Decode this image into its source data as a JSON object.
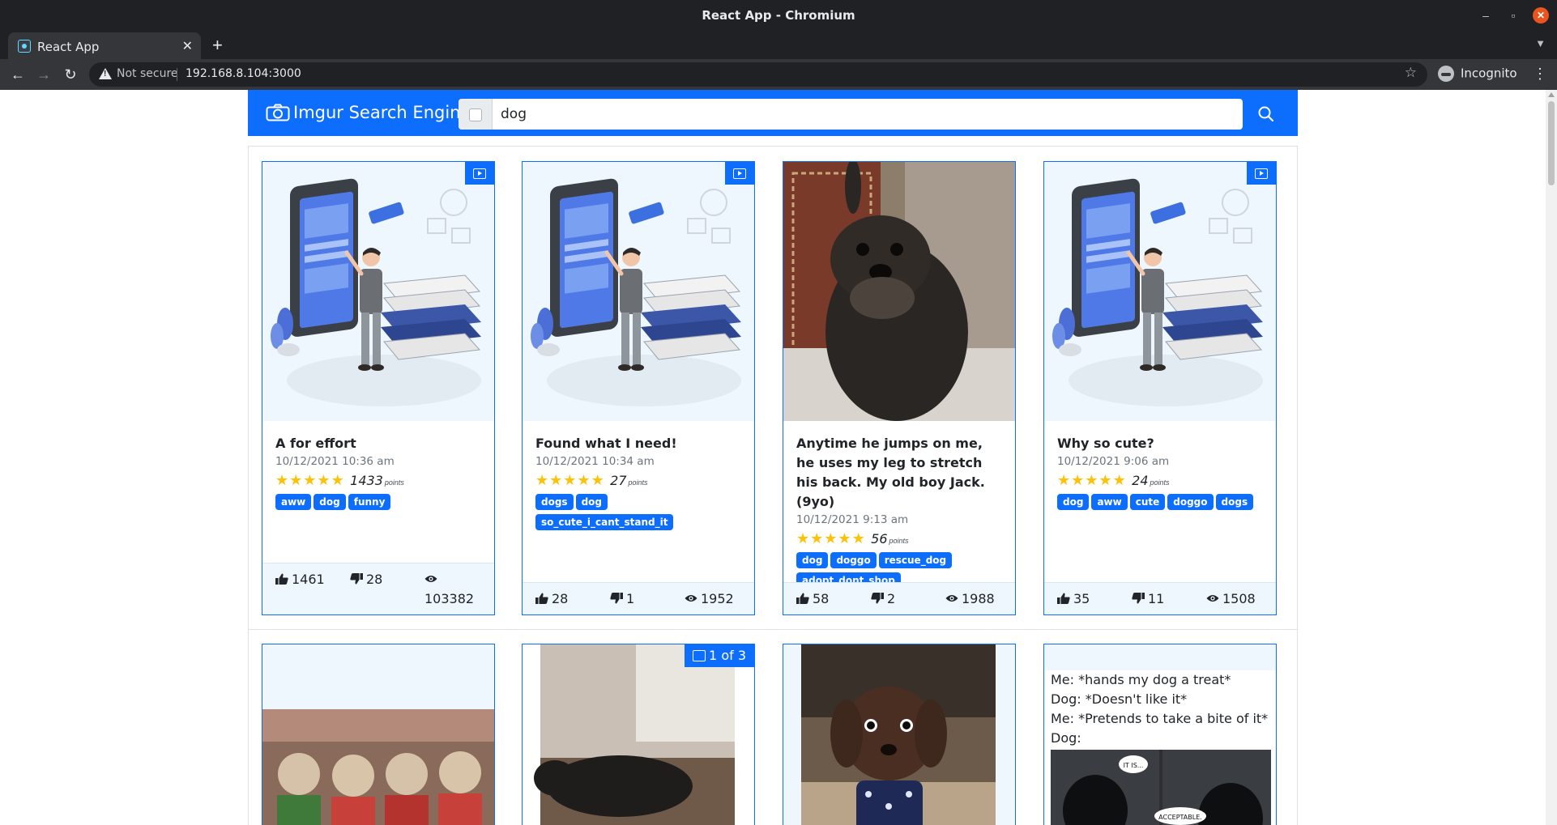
{
  "browser": {
    "window_title": "React App - Chromium",
    "tab_title": "React App",
    "security_label": "Not secure",
    "url": "192.168.8.104:3000",
    "profile_label": "Incognito"
  },
  "app": {
    "brand": "Imgur Search Engine",
    "search_value": "dog",
    "search_placeholder": "",
    "accent_color": "#0d6efd"
  },
  "cards": [
    {
      "title": "A for effort",
      "date": "10/12/2021 10:36 am",
      "points": "1433",
      "points_label": "points",
      "tags": [
        "aww",
        "dog",
        "funny"
      ],
      "ups": "1461",
      "downs": "28",
      "views": "103382",
      "media_badge": "video-icon"
    },
    {
      "title": "Found what I need!",
      "date": "10/12/2021 10:34 am",
      "points": "27",
      "points_label": "points",
      "tags": [
        "dogs",
        "dog",
        "so_cute_i_cant_stand_it"
      ],
      "ups": "28",
      "downs": "1",
      "views": "1952",
      "media_badge": "video-icon"
    },
    {
      "title": "Anytime he jumps on me, he uses my leg to stretch his back. My old boy Jack. (9yo)",
      "date": "10/12/2021 9:13 am",
      "points": "56",
      "points_label": "points",
      "tags": [
        "dog",
        "doggo",
        "rescue_dog",
        "adopt_dont_shop"
      ],
      "ups": "58",
      "downs": "2",
      "views": "1988"
    },
    {
      "title": "Why so cute?",
      "date": "10/12/2021 9:06 am",
      "points": "24",
      "points_label": "points",
      "tags": [
        "dog",
        "aww",
        "cute",
        "doggo",
        "dogs"
      ],
      "ups": "35",
      "downs": "11",
      "views": "1508",
      "media_badge": "video-icon"
    }
  ],
  "row2": {
    "album_badge": "1 of 3",
    "meme_lines": [
      "Me: *hands my dog a treat*",
      "Dog: *Doesn't like it*",
      "Me: *Pretends to take a bite of it*",
      "Dog:"
    ],
    "comic_bubble_1": "IT IS...",
    "comic_bubble_2": "ACCEPTABLE."
  }
}
